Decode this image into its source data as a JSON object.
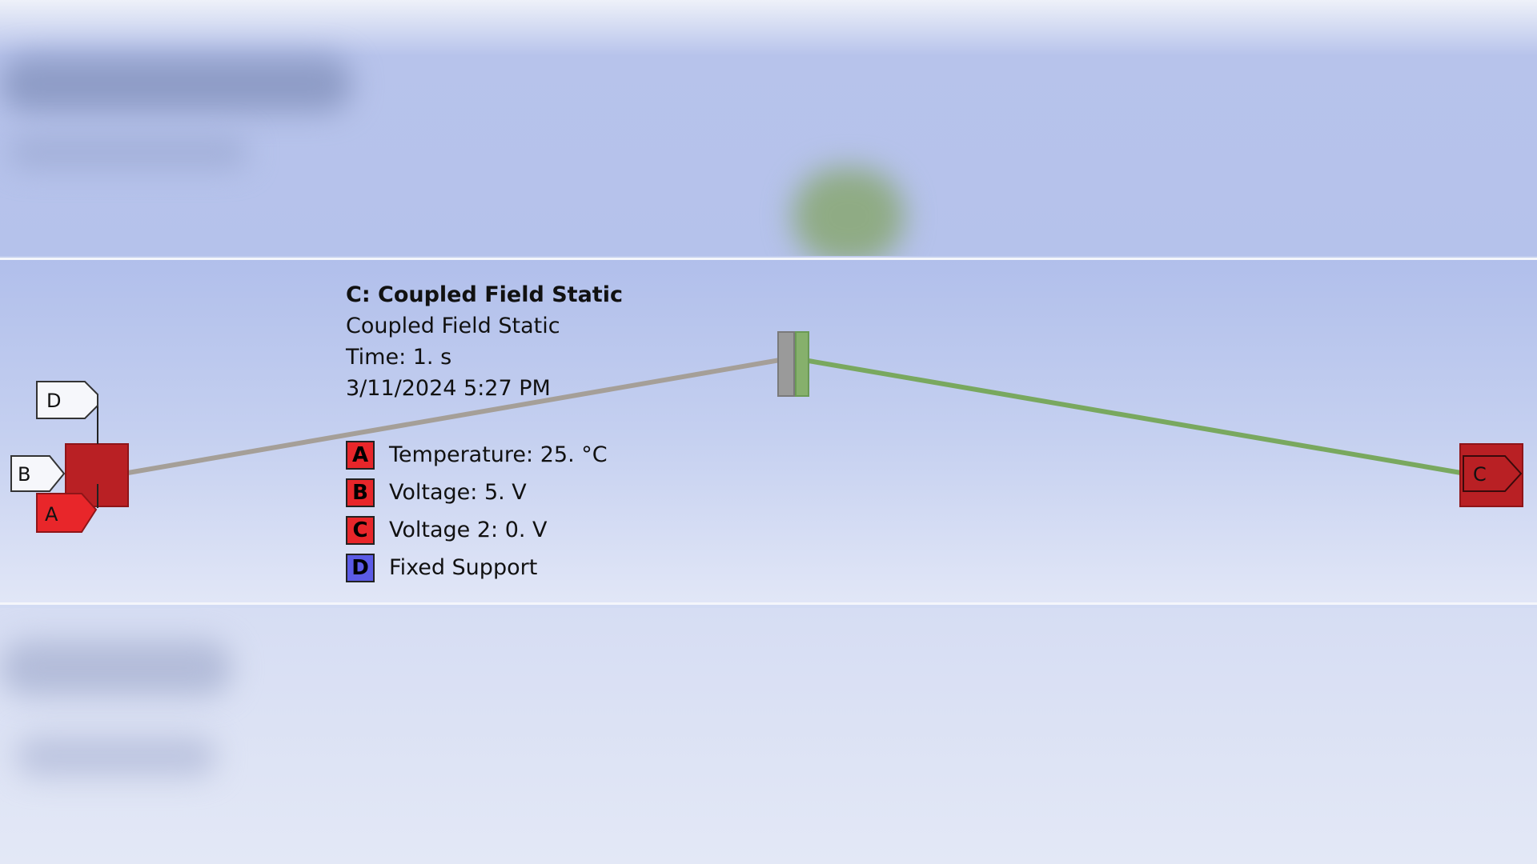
{
  "result_info": {
    "title": "C: Coupled Field Static",
    "analysis_type": "Coupled Field Static",
    "time": "Time: 1. s",
    "timestamp": "3/11/2024 5:27 PM"
  },
  "legend": [
    {
      "letter": "A",
      "label": "Temperature: 25. °C",
      "color": "#e8262a"
    },
    {
      "letter": "B",
      "label": "Voltage: 5. V",
      "color": "#e8262a"
    },
    {
      "letter": "C",
      "label": "Voltage 2: 0. V",
      "color": "#e8262a"
    },
    {
      "letter": "D",
      "label": "Fixed Support",
      "color": "#5b5be6"
    }
  ],
  "model_tags": {
    "left_end": [
      "D",
      "B",
      "A"
    ],
    "right_end": [
      "C"
    ]
  },
  "colors": {
    "line_left": "#a59f98",
    "line_right": "#79a85f",
    "end_block": "#b92024",
    "tag_red": "#e8262a",
    "tag_white": "#f6f7fb"
  }
}
